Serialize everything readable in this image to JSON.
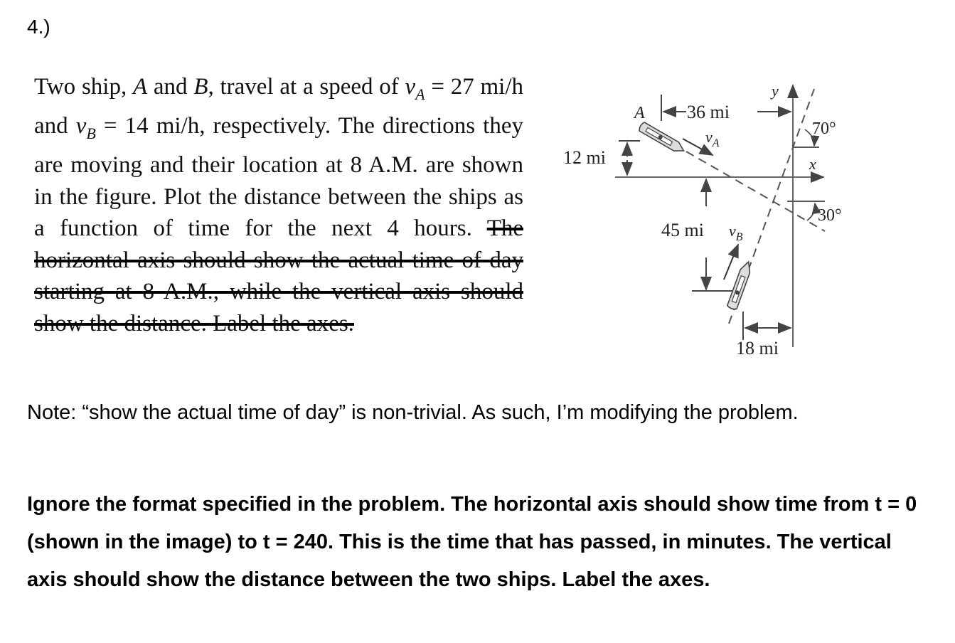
{
  "problem": {
    "number": "4.)",
    "text_parts": {
      "p1": "Two ship, ",
      "shipA": "A",
      "p2": " and ",
      "shipB": "B",
      "p3": ", travel at a speed of ",
      "vA_sym": "v",
      "vA_sub": "A",
      "vA_val": " = 27 mi/h and ",
      "vB_sym": "v",
      "vB_sub": "B",
      "vB_val": " = 14 mi/h, respectively. The directions they are moving and their location at 8 A.M. are shown in the figure. Plot the distance between the ships as a function of time for the next 4 hours. ",
      "struck": "The horizontal axis should show the actual time of day starting at 8 A.M., while the vertical axis should show the distance. Label the axes."
    }
  },
  "figure": {
    "label_A": "A",
    "dim_36": "36 mi",
    "vA": "v",
    "vA_sub": "A",
    "dim_12": "12 mi",
    "axis_y": "y",
    "axis_x": "x",
    "angle_70": "70°",
    "angle_30": "30°",
    "dim_45": "45 mi",
    "vB": "v",
    "vB_sub": "B",
    "dim_18": "18 mi",
    "colors": {
      "label_text": "#1a1a1a",
      "line": "#555555"
    }
  },
  "note": "Note: “show the actual time of day” is non-trivial. As such, I’m modifying the problem.",
  "instructions": "Ignore the format specified in the problem. The horizontal axis should show time from t = 0 (shown in the image) to t = 240. This is the time that has passed, in minutes. The vertical axis should show the distance between the two ships. Label the axes."
}
